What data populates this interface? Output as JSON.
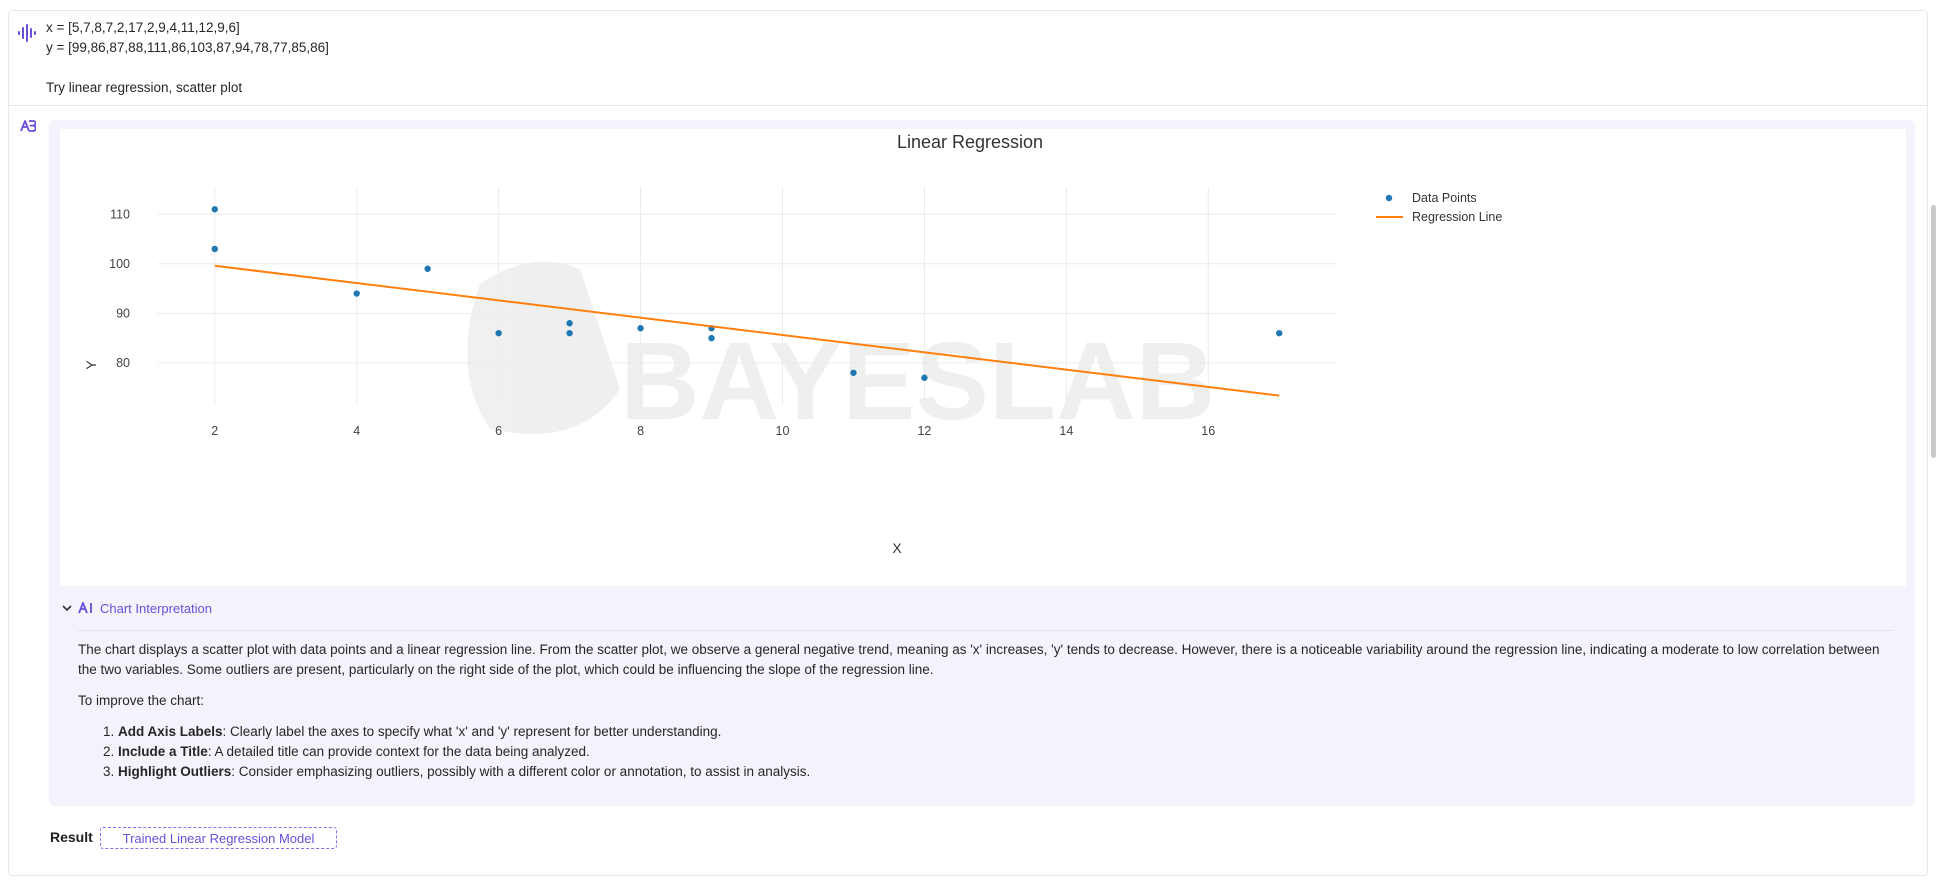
{
  "user_message": {
    "line_x": "x = [5,7,8,7,2,17,2,9,4,11,12,9,6]",
    "line_y": "y = [99,86,87,88,111,86,103,87,94,78,77,85,86]",
    "prompt": "Try linear regression, scatter plot"
  },
  "chart_data": {
    "type": "scatter",
    "title": "Linear Regression",
    "xlabel": "X",
    "ylabel": "Y",
    "xlim": [
      1.2,
      17.8
    ],
    "ylim": [
      71.5,
      115.5
    ],
    "xticks": [
      2,
      4,
      6,
      8,
      10,
      12,
      14,
      16
    ],
    "yticks": [
      80,
      90,
      100,
      110
    ],
    "grid": true,
    "legend_position": "top-right",
    "watermark": "BAYESLAB",
    "series": [
      {
        "name": "Data Points",
        "mode": "markers",
        "color": "#1f77b4",
        "x": [
          5,
          7,
          8,
          7,
          2,
          17,
          2,
          9,
          4,
          11,
          12,
          9,
          6
        ],
        "y": [
          99,
          86,
          87,
          88,
          111,
          86,
          103,
          87,
          94,
          78,
          77,
          85,
          86
        ]
      },
      {
        "name": "Regression Line",
        "mode": "line",
        "color": "#ff7f0e",
        "x": [
          2,
          17
        ],
        "y": [
          99.6,
          73.4
        ]
      }
    ]
  },
  "interpretation": {
    "header": "Chart Interpretation",
    "paragraph": "The chart displays a scatter plot with data points and a linear regression line. From the scatter plot, we observe a general negative trend, meaning as 'x' increases, 'y' tends to decrease. However, there is a noticeable variability around the regression line, indicating a moderate to low correlation between the two variables. Some outliers are present, particularly on the right side of the plot, which could be influencing the slope of the regression line.",
    "intro": "To improve the chart:",
    "items": [
      {
        "title": "Add Axis Labels",
        "text": ": Clearly label the axes to specify what 'x' and 'y' represent for better understanding."
      },
      {
        "title": "Include a Title",
        "text": ": A detailed title can provide context for the data being analyzed."
      },
      {
        "title": "Highlight Outliers",
        "text": ": Consider emphasizing outliers, possibly with a different color or annotation, to assist in analysis."
      }
    ]
  },
  "result": {
    "label": "Result",
    "button_label": "Trained Linear Regression Model"
  },
  "icons": {
    "user": "voice-wave-icon",
    "assistant": "assistant-logo-icon",
    "interpretation": "ai-sparkle-icon",
    "collapse": "chevron-down-icon"
  },
  "colors": {
    "accent": "#6b4fd8",
    "card_bg": "#f4f3fb",
    "points": "#1f77b4",
    "line": "#ff7f0e"
  }
}
